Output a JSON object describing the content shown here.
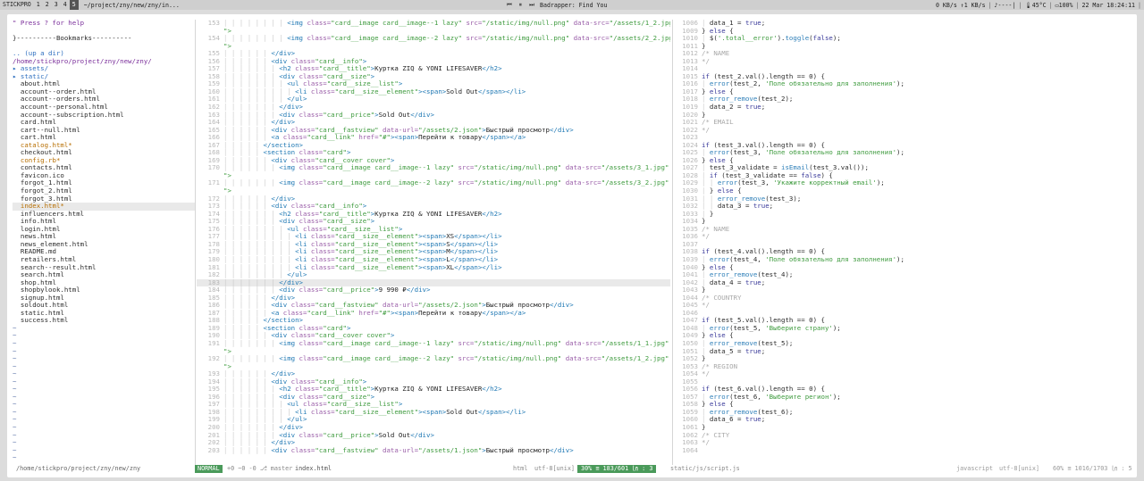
{
  "topbar": {
    "ws_label": "STICKPRO",
    "workspaces": [
      "1",
      "2",
      "3",
      "4",
      "5"
    ],
    "active": "5",
    "window_title": "~/project/zny/new/zny/in...",
    "music": "Badrapper: Find You",
    "net": "0 KB/s ↑1 KB/s",
    "vol": "----|",
    "temp": "45°C",
    "battery": "100%",
    "datetime": "22 Mar 18:24:11"
  },
  "tree": {
    "help": "\" Press ? for help",
    "bookmarks": "}----------Bookmarks----------",
    "up": ".. (up a dir)",
    "root": "/home/stickpro/project/zny/new/zny/",
    "items": [
      "▸ assets/",
      "▸ static/",
      "about.html",
      "account--order.html",
      "account--orders.html",
      "account--personal.html",
      "account--subscription.html",
      "card.html",
      "cart--null.html",
      "cart.html",
      "catalog.html*",
      "checkout.html",
      "config.rb*",
      "contacts.html",
      "favicon.ico",
      "forgot_1.html",
      "forgot_2.html",
      "forgot_3.html",
      "index.html*",
      "influencers.html",
      "info.html",
      "login.html",
      "news.html",
      "news_element.html",
      "README.md",
      "retailers.html",
      "search--result.html",
      "search.html",
      "shop.html",
      "shopbylook.html",
      "signup.html",
      "soldout.html",
      "static.html",
      "success.html"
    ],
    "tildes": [
      "~",
      "~",
      "~",
      "~",
      "~",
      "~",
      "~",
      "~",
      "~",
      "~",
      "~",
      "~",
      "~",
      "~",
      "~",
      "~",
      "~",
      "~",
      "~"
    ]
  },
  "code_lines": [
    [
      "153",
      "│ │ │ │ │ │ │ │ ",
      "<img class=\"card__image card__image--1 lazy\" src=\"/static/img/null.png\" data-src=\"/assets/1_2.jpg\" alt="
    ],
    [
      "",
      "",
      "\">"
    ],
    [
      "154",
      "│ │ │ │ │ │ │ │ ",
      "<img class=\"card__image card__image--2 lazy\" src=\"/static/img/null.png\" data-src=\"/assets/2_2.jpg\" alt="
    ],
    [
      "",
      "",
      "\">"
    ],
    [
      "155",
      "│ │ │ │ │ │ ",
      "</div>"
    ],
    [
      "156",
      "│ │ │ │ │ │ ",
      "<div class=\"card__info\">"
    ],
    [
      "157",
      "│ │ │ │ │ │ │ ",
      "<h2 class=\"card__title\">Куртка ZIQ & YONI LIFESAVER</h2>"
    ],
    [
      "158",
      "│ │ │ │ │ │ │ ",
      "<div class=\"card__size\">"
    ],
    [
      "159",
      "│ │ │ │ │ │ │ │ ",
      "<ul class=\"card__size__list\">"
    ],
    [
      "160",
      "│ │ │ │ │ │ │ │ │ ",
      "<li class=\"card__size__element\"><span>Sold Out</span></li>"
    ],
    [
      "161",
      "│ │ │ │ │ │ │ │ ",
      "</ul>"
    ],
    [
      "162",
      "│ │ │ │ │ │ │ ",
      "</div>"
    ],
    [
      "163",
      "│ │ │ │ │ │ │ ",
      "<div class=\"card__price\">Sold Out</div>"
    ],
    [
      "164",
      "│ │ │ │ │ │ ",
      "</div>"
    ],
    [
      "165",
      "│ │ │ │ │ │ ",
      "<div class=\"card__fastview\" data-url=\"/assets/2.json\">Быстрый просмотр</div>"
    ],
    [
      "166",
      "│ │ │ │ │ │ ",
      "<a class=\"card__link\" href=\"#\"><span>Перейти к товару</span></a>"
    ],
    [
      "167",
      "│ │ │ │ │ ",
      "</section>"
    ],
    [
      "168",
      "│ │ │ │ │ ",
      "<section class=\"card\">"
    ],
    [
      "169",
      "│ │ │ │ │ │ ",
      "<div class=\"card__cover cover\">"
    ],
    [
      "170",
      "│ │ │ │ │ │ │ ",
      "<img class=\"card__image card__image--1 lazy\" src=\"/static/img/null.png\" data-src=\"/assets/3_1.jpg\" alt="
    ],
    [
      "",
      "",
      "\">"
    ],
    [
      "171",
      "│ │ │ │ │ │ │ ",
      "<img class=\"card__image card__image--2 lazy\" src=\"/static/img/null.png\" data-src=\"/assets/3_2.jpg\" alt="
    ],
    [
      "",
      "",
      "\">"
    ],
    [
      "172",
      "│ │ │ │ │ │ ",
      "</div>"
    ],
    [
      "173",
      "│ │ │ │ │ │ ",
      "<div class=\"card__info\">"
    ],
    [
      "174",
      "│ │ │ │ │ │ │ ",
      "<h2 class=\"card__title\">Куртка ZIQ & YONI LIFESAVER</h2>"
    ],
    [
      "175",
      "│ │ │ │ │ │ │ ",
      "<div class=\"card__size\">"
    ],
    [
      "176",
      "│ │ │ │ │ │ │ │ ",
      "<ul class=\"card__size__list\">"
    ],
    [
      "177",
      "│ │ │ │ │ │ │ │ │ ",
      "<li class=\"card__size__element\"><span>XS</span></li>"
    ],
    [
      "178",
      "│ │ │ │ │ │ │ │ │ ",
      "<li class=\"card__size__element\"><span>S</span></li>"
    ],
    [
      "179",
      "│ │ │ │ │ │ │ │ │ ",
      "<li class=\"card__size__element\"><span>M</span></li>"
    ],
    [
      "180",
      "│ │ │ │ │ │ │ │ │ ",
      "<li class=\"card__size__element\"><span>L</span></li>"
    ],
    [
      "181",
      "│ │ │ │ │ │ │ │ │ ",
      "<li class=\"card__size__element\"><span>XL</span></li>"
    ],
    [
      "182",
      "│ │ │ │ │ │ │ │ ",
      "</ul>"
    ],
    [
      "183",
      "│ │ │ │ │ │ │ ",
      "</div>"
    ],
    [
      "184",
      "│ │ │ │ │ │ │ ",
      "<div class=\"card__price\">9 990 ₽</div>"
    ],
    [
      "185",
      "│ │ │ │ │ │ ",
      "</div>"
    ],
    [
      "186",
      "│ │ │ │ │ │ ",
      "<div class=\"card__fastview\" data-url=\"/assets/2.json\">Быстрый просмотр</div>"
    ],
    [
      "187",
      "│ │ │ │ │ │ ",
      "<a class=\"card__link\" href=\"#\"><span>Перейти к товару</span></a>"
    ],
    [
      "188",
      "│ │ │ │ │ ",
      "</section>"
    ],
    [
      "189",
      "│ │ │ │ │ ",
      "<section class=\"card\">"
    ],
    [
      "190",
      "│ │ │ │ │ │ ",
      "<div class=\"card__cover cover\">"
    ],
    [
      "191",
      "│ │ │ │ │ │ │ ",
      "<img class=\"card__image card__image--1 lazy\" src=\"/static/img/null.png\" data-src=\"/assets/1_1.jpg\" alt="
    ],
    [
      "",
      "",
      "\">"
    ],
    [
      "192",
      "│ │ │ │ │ │ │ ",
      "<img class=\"card__image card__image--2 lazy\" src=\"/static/img/null.png\" data-src=\"/assets/1_2.jpg\" alt="
    ],
    [
      "",
      "",
      "\">"
    ],
    [
      "193",
      "│ │ │ │ │ │ ",
      "</div>"
    ],
    [
      "194",
      "│ │ │ │ │ │ ",
      "<div class=\"card__info\">"
    ],
    [
      "195",
      "│ │ │ │ │ │ │ ",
      "<h2 class=\"card__title\">Куртка ZIQ & YONI LIFESAVER</h2>"
    ],
    [
      "196",
      "│ │ │ │ │ │ │ ",
      "<div class=\"card__size\">"
    ],
    [
      "197",
      "│ │ │ │ │ │ │ │ ",
      "<ul class=\"card__size__list\">"
    ],
    [
      "198",
      "│ │ │ │ │ │ │ │ │ ",
      "<li class=\"card__size__element\"><span>Sold Out</span></li>"
    ],
    [
      "199",
      "│ │ │ │ │ │ │ │ ",
      "</ul>"
    ],
    [
      "200",
      "│ │ │ │ │ │ │ ",
      "</div>"
    ],
    [
      "201",
      "│ │ │ │ │ │ │ ",
      "<div class=\"card__price\">Sold Out</div>"
    ],
    [
      "202",
      "│ │ │ │ │ │ ",
      "</div>"
    ],
    [
      "203",
      "│ │ │ │ │ │ ",
      "<div class=\"card__fastview\" data-url=\"/assets/1.json\">Быстрый просмотр</div>"
    ]
  ],
  "js_lines": [
    [
      "1006",
      "│ ",
      "data_1 = true;"
    ],
    [
      "1009",
      "",
      "} else {"
    ],
    [
      "1010",
      "│ ",
      "$('.total__error').toggle(false);"
    ],
    [
      "1011",
      "",
      "}"
    ],
    [
      "1012",
      "",
      "/* NAME"
    ],
    [
      "1013",
      "",
      "*/"
    ],
    [
      "1014",
      "",
      ""
    ],
    [
      "1015",
      "",
      "if (test_2.val().length == 0) {"
    ],
    [
      "1016",
      "│ ",
      "error(test_2, 'Поле обязательно для заполнения');"
    ],
    [
      "1017",
      "",
      "} else {"
    ],
    [
      "1018",
      "│ ",
      "error_remove(test_2);"
    ],
    [
      "1019",
      "│ ",
      "data_2 = true;"
    ],
    [
      "1020",
      "",
      "}"
    ],
    [
      "1021",
      "",
      "/* EMAIL"
    ],
    [
      "1022",
      "",
      "*/"
    ],
    [
      "1023",
      "",
      ""
    ],
    [
      "1024",
      "",
      "if (test_3.val().length == 0) {"
    ],
    [
      "1025",
      "│ ",
      "error(test_3, 'Поле обязательно для заполнения');"
    ],
    [
      "1026",
      "",
      "} else {"
    ],
    [
      "1027",
      "│ ",
      "test_3_validate = isEmail(test_3.val());"
    ],
    [
      "1028",
      "│ ",
      "if (test_3_validate == false) {"
    ],
    [
      "1029",
      "│ │ ",
      "error(test_3, 'Укажите корректный email');"
    ],
    [
      "1030",
      "│ ",
      "} else {"
    ],
    [
      "1031",
      "│ │ ",
      "error_remove(test_3);"
    ],
    [
      "1032",
      "│ │ ",
      "data_3 = true;"
    ],
    [
      "1033",
      "│ ",
      "}"
    ],
    [
      "1034",
      "",
      "}"
    ],
    [
      "1035",
      "",
      "/* NAME"
    ],
    [
      "1036",
      "",
      "*/"
    ],
    [
      "1037",
      "",
      ""
    ],
    [
      "1038",
      "",
      "if (test_4.val().length == 0) {"
    ],
    [
      "1039",
      "│ ",
      "error(test_4, 'Поле обязательно для заполнения');"
    ],
    [
      "1040",
      "",
      "} else {"
    ],
    [
      "1041",
      "│ ",
      "error_remove(test_4);"
    ],
    [
      "1042",
      "│ ",
      "data_4 = true;"
    ],
    [
      "1043",
      "",
      "}"
    ],
    [
      "1044",
      "",
      "/* COUNTRY"
    ],
    [
      "1045",
      "",
      "*/"
    ],
    [
      "1046",
      "",
      ""
    ],
    [
      "1047",
      "",
      "if (test_5.val().length == 0) {"
    ],
    [
      "1048",
      "│ ",
      "error(test_5, 'Выберите страну');"
    ],
    [
      "1049",
      "",
      "} else {"
    ],
    [
      "1050",
      "│ ",
      "error_remove(test_5);"
    ],
    [
      "1051",
      "│ ",
      "data_5 = true;"
    ],
    [
      "1052",
      "",
      "}"
    ],
    [
      "1053",
      "",
      "/* REGION"
    ],
    [
      "1054",
      "",
      "*/"
    ],
    [
      "1055",
      "",
      ""
    ],
    [
      "1056",
      "",
      "if (test_6.val().length == 0) {"
    ],
    [
      "1057",
      "│ ",
      "error(test_6, 'Выберите регион');"
    ],
    [
      "1058",
      "",
      "} else {"
    ],
    [
      "1059",
      "│ ",
      "error_remove(test_6);"
    ],
    [
      "1060",
      "│ ",
      "data_6 = true;"
    ],
    [
      "1061",
      "",
      "}"
    ],
    [
      "1062",
      "",
      "/* CITY"
    ],
    [
      "1063",
      "",
      "*/"
    ],
    [
      "1064",
      "",
      ""
    ]
  ],
  "status": {
    "tree_path": "/home/stickpro/project/zny/new/zny",
    "mode": "NORMAL",
    "git": "+0 ~0 -0 ⎇ master",
    "file": "index.html",
    "ft": "html",
    "enc": "utf-8[unix]",
    "pct": "30% ≡ 183/601 ㏑ : 3",
    "js_file": "static/js/script.js",
    "js_ft": "javascript",
    "js_enc": "utf-8[unix]",
    "js_pos": "60% ≡ 1016/1703 ㏑ : 5"
  },
  "colors": {
    "mode_bg": "#4a9a5a",
    "tag": "#1f78b4",
    "string": "#3f9b3f"
  }
}
